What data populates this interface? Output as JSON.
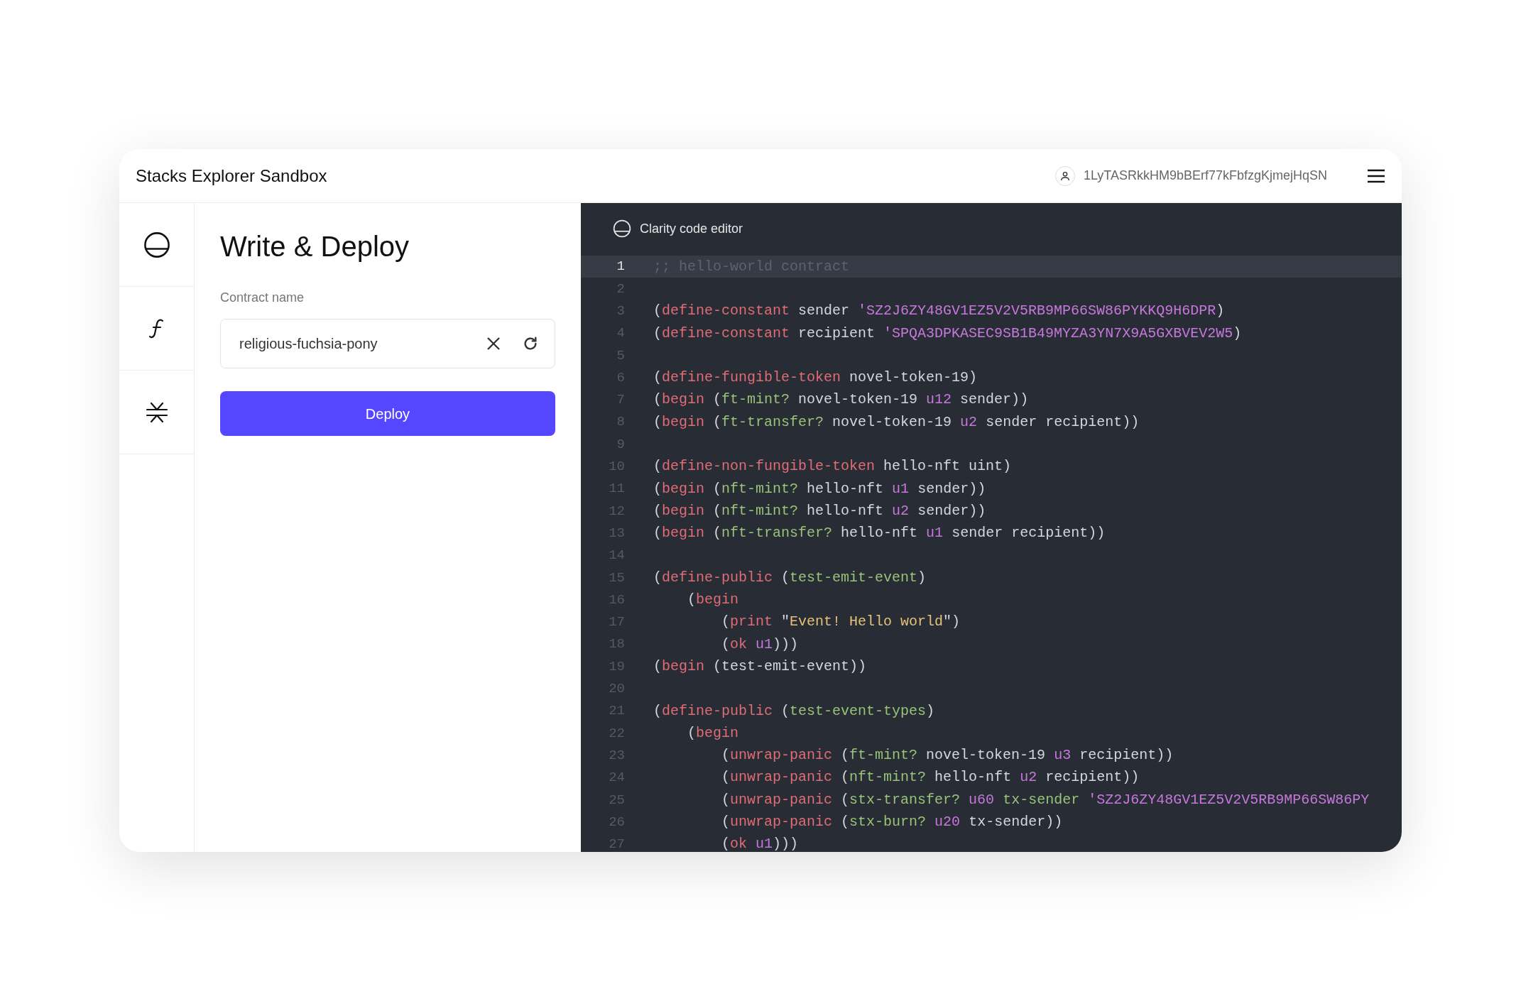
{
  "window": {
    "title": "Stacks Explorer Sandbox"
  },
  "account": {
    "address": "1LyTASRkkHM9bBErf77kFbfzgKjmejHqSN"
  },
  "form": {
    "title": "Write & Deploy",
    "field_label": "Contract name",
    "field_value": "religious-fuchsia-pony",
    "button": "Deploy"
  },
  "editor": {
    "title": "Clarity code editor",
    "lines": [
      {
        "number": "1",
        "current": true,
        "tokens": [
          {
            "kind": "comment",
            "text": ";; hello-world contract"
          }
        ]
      },
      {
        "number": "2",
        "current": false
      },
      {
        "number": "3",
        "current": false,
        "tokens": [
          {
            "kind": "plain",
            "text": "("
          },
          {
            "kind": "keyword",
            "text": "define-constant"
          },
          {
            "kind": "plain",
            "text": " sender "
          },
          {
            "kind": "literal",
            "text": "'SZ2J6ZY48GV1EZ5V2V5RB9MP66SW86PYKKQ9H6DPR"
          },
          {
            "kind": "plain",
            "text": ")"
          }
        ]
      },
      {
        "number": "4",
        "current": false,
        "tokens": [
          {
            "kind": "plain",
            "text": "("
          },
          {
            "kind": "keyword",
            "text": "define-constant"
          },
          {
            "kind": "plain",
            "text": " recipient "
          },
          {
            "kind": "literal",
            "text": "'SPQA3DPKASEC9SB1B49MYZA3YN7X9A5GXBVEV2W5"
          },
          {
            "kind": "plain",
            "text": ")"
          }
        ]
      },
      {
        "number": "5",
        "current": false
      },
      {
        "number": "6",
        "current": false,
        "tokens": [
          {
            "kind": "plain",
            "text": "("
          },
          {
            "kind": "keyword",
            "text": "define-fungible-token"
          },
          {
            "kind": "plain",
            "text": " novel-token-19)"
          }
        ]
      },
      {
        "number": "7",
        "current": false,
        "tokens": [
          {
            "kind": "plain",
            "text": "("
          },
          {
            "kind": "keyword",
            "text": "begin"
          },
          {
            "kind": "plain",
            "text": " ("
          },
          {
            "kind": "function",
            "text": "ft-mint?"
          },
          {
            "kind": "plain",
            "text": " novel-token-19 "
          },
          {
            "kind": "literal",
            "text": "u12"
          },
          {
            "kind": "plain",
            "text": " sender))"
          }
        ]
      },
      {
        "number": "8",
        "current": false,
        "tokens": [
          {
            "kind": "plain",
            "text": "("
          },
          {
            "kind": "keyword",
            "text": "begin"
          },
          {
            "kind": "plain",
            "text": " ("
          },
          {
            "kind": "function",
            "text": "ft-transfer?"
          },
          {
            "kind": "plain",
            "text": " novel-token-19 "
          },
          {
            "kind": "literal",
            "text": "u2"
          },
          {
            "kind": "plain",
            "text": " sender recipient))"
          }
        ]
      },
      {
        "number": "9",
        "current": false
      },
      {
        "number": "10",
        "current": false,
        "tokens": [
          {
            "kind": "plain",
            "text": "("
          },
          {
            "kind": "keyword",
            "text": "define-non-fungible-token"
          },
          {
            "kind": "plain",
            "text": " hello-nft uint)"
          }
        ]
      },
      {
        "number": "11",
        "current": false,
        "tokens": [
          {
            "kind": "plain",
            "text": "("
          },
          {
            "kind": "keyword",
            "text": "begin"
          },
          {
            "kind": "plain",
            "text": " ("
          },
          {
            "kind": "function",
            "text": "nft-mint?"
          },
          {
            "kind": "plain",
            "text": " hello-nft "
          },
          {
            "kind": "literal",
            "text": "u1"
          },
          {
            "kind": "plain",
            "text": " sender))"
          }
        ]
      },
      {
        "number": "12",
        "current": false,
        "tokens": [
          {
            "kind": "plain",
            "text": "("
          },
          {
            "kind": "keyword",
            "text": "begin"
          },
          {
            "kind": "plain",
            "text": " ("
          },
          {
            "kind": "function",
            "text": "nft-mint?"
          },
          {
            "kind": "plain",
            "text": " hello-nft "
          },
          {
            "kind": "literal",
            "text": "u2"
          },
          {
            "kind": "plain",
            "text": " sender))"
          }
        ]
      },
      {
        "number": "13",
        "current": false,
        "tokens": [
          {
            "kind": "plain",
            "text": "("
          },
          {
            "kind": "keyword",
            "text": "begin"
          },
          {
            "kind": "plain",
            "text": " ("
          },
          {
            "kind": "function",
            "text": "nft-transfer?"
          },
          {
            "kind": "plain",
            "text": " hello-nft "
          },
          {
            "kind": "literal",
            "text": "u1"
          },
          {
            "kind": "plain",
            "text": " sender recipient))"
          }
        ]
      },
      {
        "number": "14",
        "current": false
      },
      {
        "number": "15",
        "current": false,
        "tokens": [
          {
            "kind": "plain",
            "text": "("
          },
          {
            "kind": "keyword",
            "text": "define-public"
          },
          {
            "kind": "plain",
            "text": " ("
          },
          {
            "kind": "function",
            "text": "test-emit-event"
          },
          {
            "kind": "plain",
            "text": ")"
          }
        ]
      },
      {
        "number": "16",
        "current": false,
        "tokens": [
          {
            "kind": "plain",
            "text": "    ("
          },
          {
            "kind": "keyword",
            "text": "begin"
          }
        ]
      },
      {
        "number": "17",
        "current": false,
        "tokens": [
          {
            "kind": "plain",
            "text": "        ("
          },
          {
            "kind": "keyword",
            "text": "print"
          },
          {
            "kind": "plain",
            "text": " \""
          },
          {
            "kind": "string",
            "text": "Event! Hello world"
          },
          {
            "kind": "plain",
            "text": "\")"
          }
        ]
      },
      {
        "number": "18",
        "current": false,
        "tokens": [
          {
            "kind": "plain",
            "text": "        ("
          },
          {
            "kind": "keyword",
            "text": "ok"
          },
          {
            "kind": "literal",
            "text": " u1"
          },
          {
            "kind": "plain",
            "text": ")))"
          }
        ]
      },
      {
        "number": "19",
        "current": false,
        "tokens": [
          {
            "kind": "plain",
            "text": "("
          },
          {
            "kind": "keyword",
            "text": "begin"
          },
          {
            "kind": "plain",
            "text": " (test-emit-event))"
          }
        ]
      },
      {
        "number": "20",
        "current": false
      },
      {
        "number": "21",
        "current": false,
        "tokens": [
          {
            "kind": "plain",
            "text": "("
          },
          {
            "kind": "keyword",
            "text": "define-public"
          },
          {
            "kind": "plain",
            "text": " ("
          },
          {
            "kind": "function",
            "text": "test-event-types"
          },
          {
            "kind": "plain",
            "text": ")"
          }
        ]
      },
      {
        "number": "22",
        "current": false,
        "tokens": [
          {
            "kind": "plain",
            "text": "    ("
          },
          {
            "kind": "keyword",
            "text": "begin"
          }
        ]
      },
      {
        "number": "23",
        "current": false,
        "tokens": [
          {
            "kind": "plain",
            "text": "        ("
          },
          {
            "kind": "keyword",
            "text": "unwrap-panic"
          },
          {
            "kind": "plain",
            "text": " ("
          },
          {
            "kind": "function",
            "text": "ft-mint?"
          },
          {
            "kind": "plain",
            "text": " novel-token-19 "
          },
          {
            "kind": "literal",
            "text": "u3"
          },
          {
            "kind": "plain",
            "text": " recipient))"
          }
        ]
      },
      {
        "number": "24",
        "current": false,
        "tokens": [
          {
            "kind": "plain",
            "text": "        ("
          },
          {
            "kind": "keyword",
            "text": "unwrap-panic"
          },
          {
            "kind": "plain",
            "text": " ("
          },
          {
            "kind": "function",
            "text": "nft-mint?"
          },
          {
            "kind": "plain",
            "text": " hello-nft "
          },
          {
            "kind": "literal",
            "text": "u2"
          },
          {
            "kind": "plain",
            "text": " recipient))"
          }
        ]
      },
      {
        "number": "25",
        "current": false,
        "tokens": [
          {
            "kind": "plain",
            "text": "        ("
          },
          {
            "kind": "keyword",
            "text": "unwrap-panic"
          },
          {
            "kind": "plain",
            "text": " ("
          },
          {
            "kind": "function",
            "text": "stx-transfer?"
          },
          {
            "kind": "literal",
            "text": " u60"
          },
          {
            "kind": "function",
            "text": " tx-sender"
          },
          {
            "kind": "literal",
            "text": " 'SZ2J6ZY48GV1EZ5V2V5RB9MP66SW86PY"
          }
        ]
      },
      {
        "number": "26",
        "current": false,
        "tokens": [
          {
            "kind": "plain",
            "text": "        ("
          },
          {
            "kind": "keyword",
            "text": "unwrap-panic"
          },
          {
            "kind": "plain",
            "text": " ("
          },
          {
            "kind": "function",
            "text": "stx-burn?"
          },
          {
            "kind": "literal",
            "text": " u20"
          },
          {
            "kind": "plain",
            "text": " tx-sender))"
          }
        ]
      },
      {
        "number": "27",
        "current": false,
        "tokens": [
          {
            "kind": "plain",
            "text": "        ("
          },
          {
            "kind": "keyword",
            "text": "ok"
          },
          {
            "kind": "literal",
            "text": " u1"
          },
          {
            "kind": "plain",
            "text": ")))"
          }
        ]
      }
    ]
  }
}
